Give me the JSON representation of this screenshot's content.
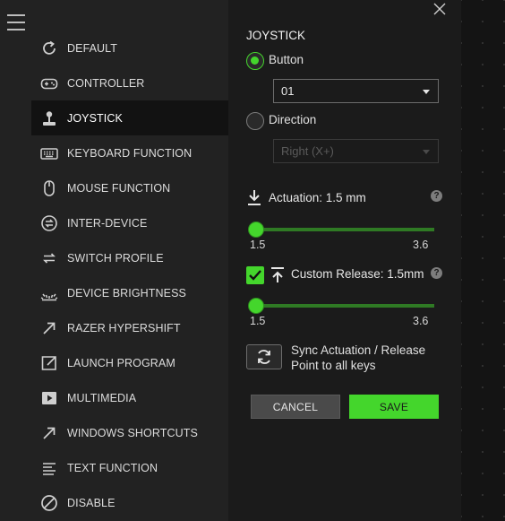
{
  "sidebar": {
    "items": [
      {
        "label": "DEFAULT",
        "icon": "refresh-icon"
      },
      {
        "label": "CONTROLLER",
        "icon": "gamepad-icon"
      },
      {
        "label": "JOYSTICK",
        "icon": "joystick-icon",
        "active": true
      },
      {
        "label": "KEYBOARD FUNCTION",
        "icon": "keyboard-icon"
      },
      {
        "label": "MOUSE FUNCTION",
        "icon": "mouse-icon"
      },
      {
        "label": "INTER-DEVICE",
        "icon": "inter-device-icon"
      },
      {
        "label": "SWITCH PROFILE",
        "icon": "switch-arrows-icon"
      },
      {
        "label": "DEVICE BRIGHTNESS",
        "icon": "brightness-icon"
      },
      {
        "label": "RAZER HYPERSHIFT",
        "icon": "diagonal-arrow-icon"
      },
      {
        "label": "LAUNCH PROGRAM",
        "icon": "launch-icon"
      },
      {
        "label": "MULTIMEDIA",
        "icon": "play-icon"
      },
      {
        "label": "WINDOWS SHORTCUTS",
        "icon": "diagonal-arrow-icon"
      },
      {
        "label": "TEXT FUNCTION",
        "icon": "text-lines-icon"
      },
      {
        "label": "DISABLE",
        "icon": "disable-icon"
      }
    ]
  },
  "panel": {
    "title": "JOYSTICK",
    "button_option": {
      "label": "Button",
      "selected": true,
      "value": "01"
    },
    "direction_option": {
      "label": "Direction",
      "selected": false,
      "value": "Right (X+)"
    },
    "actuation": {
      "label": "Actuation: 1.5 mm",
      "min_label": "1.5",
      "max_label": "3.6",
      "min": 1.5,
      "max": 3.6,
      "value": 1.5
    },
    "custom_release": {
      "label": "Custom Release: 1.5mm",
      "checked": true,
      "min_label": "1.5",
      "max_label": "3.6",
      "min": 1.5,
      "max": 3.6,
      "value": 1.5
    },
    "sync_label": "Sync Actuation / Release Point to all keys",
    "help_glyph": "?",
    "cancel_label": "CANCEL",
    "save_label": "SAVE"
  },
  "colors": {
    "accent": "#44d62c",
    "sidebar_bg": "#222222",
    "panel_bg": "#1b1b1b",
    "active_item_bg": "#121212"
  }
}
